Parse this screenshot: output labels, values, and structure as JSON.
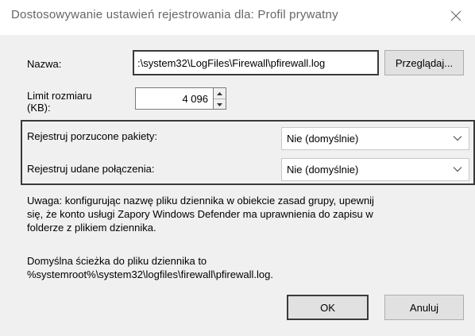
{
  "window": {
    "title": "Dostosowywanie ustawień rejestrowania dla: Profil prywatny",
    "close_icon": "close-icon"
  },
  "name": {
    "label": "Nazwa:",
    "value": ":\\system32\\LogFiles\\Firewall\\pfirewall.log",
    "browse_label": "Przeglądaj..."
  },
  "size_limit": {
    "label_line1": "Limit rozmiaru",
    "label_line2": "(KB):",
    "value": "4 096"
  },
  "logging": {
    "dropped_label": "Rejestruj porzucone pakiety:",
    "dropped_value": "Nie (domyślnie)",
    "success_label": "Rejestruj udane połączenia:",
    "success_value": "Nie (domyślnie)"
  },
  "note": {
    "line1": "Uwaga: konfigurując nazwę pliku dziennika w obiekcie zasad grupy, upewnij",
    "line2": "się, że konto usługi Zapory Windows Defender ma uprawnienia do zapisu w",
    "line3": "folderze z plikiem dziennika."
  },
  "default_path": {
    "line1": "Domyślna ścieżka do pliku dziennika to",
    "line2": "%systemroot%\\system32\\logfiles\\firewall\\pfirewall.log."
  },
  "buttons": {
    "ok_label": "OK",
    "cancel_label": "Anuluj"
  }
}
